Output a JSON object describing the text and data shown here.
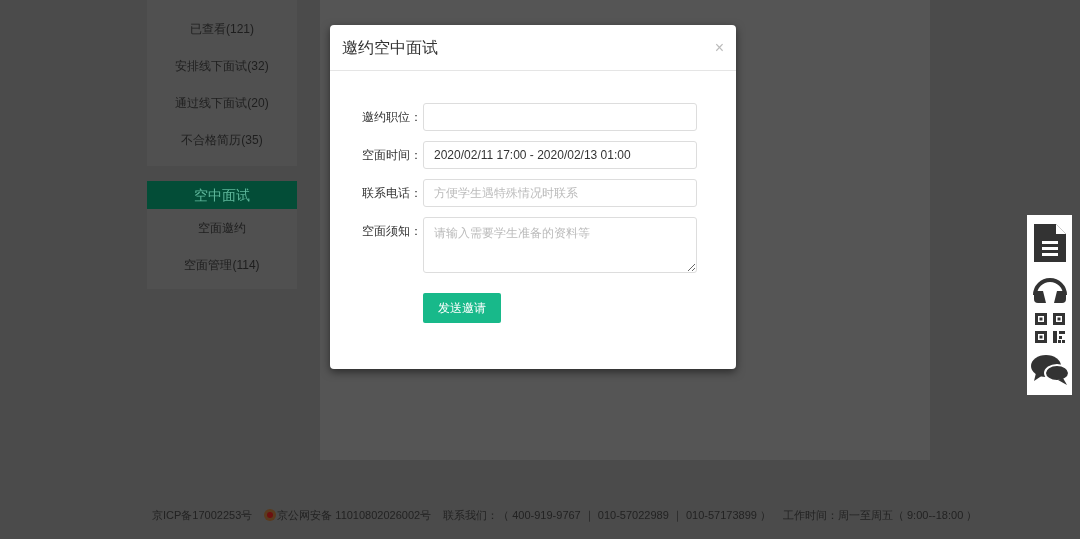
{
  "sidebar": {
    "items": [
      "已查看(121)",
      "安排线下面试(32)",
      "通过线下面试(20)",
      "不合格简历(35)"
    ],
    "section": {
      "title": "空中面试",
      "items": [
        "空面邀约",
        "空面管理(114)"
      ]
    }
  },
  "dialog": {
    "title": "邀约空中面试",
    "close": "×",
    "fields": [
      {
        "kind": "input",
        "label": "邀约职位："
      },
      {
        "kind": "input",
        "label": "空面时间：",
        "value": "2020/02/11 17:00 - 2020/02/13 01:00"
      },
      {
        "kind": "input",
        "label": "联系电话：",
        "placeholder": "方便学生遇特殊情况时联系"
      },
      {
        "kind": "textarea",
        "label": "空面须知：",
        "placeholder": "请输入需要学生准备的资料等"
      }
    ],
    "submit": "发送邀请"
  },
  "footer": {
    "icp": "京ICP备17002253号",
    "police": "京公网安备 11010802026002号",
    "contact": "联系我们：（ 400-919-9767 ｜ 010-57022989 ｜ 010-57173899 ）",
    "hours": "工作时间：周一至周五（ 9:00--18:00 ）"
  },
  "float_toolbar": [
    {
      "kind": "document"
    },
    {
      "kind": "headset"
    },
    {
      "kind": "qrcode"
    },
    {
      "kind": "chat"
    }
  ]
}
